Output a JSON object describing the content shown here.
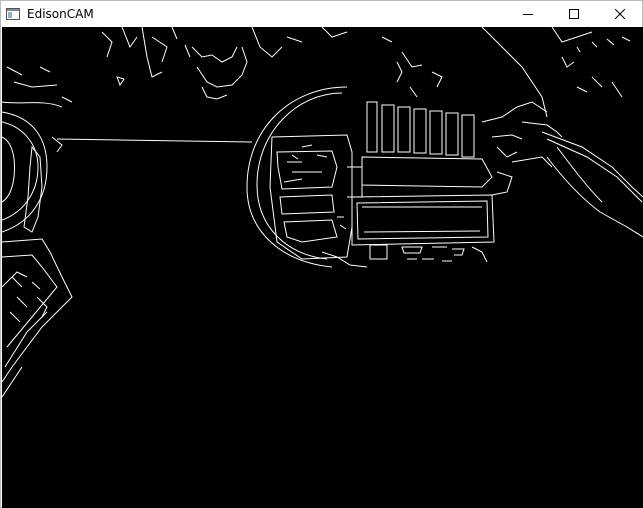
{
  "window": {
    "title": "EdisonCAM",
    "app_icon": "window-app-icon",
    "controls": {
      "minimize": "minimize-icon",
      "maximize": "maximize-icon",
      "close": "close-icon"
    }
  },
  "view": {
    "content": "edge-detection-output",
    "background": "#000000",
    "edge_color": "#ffffff"
  }
}
